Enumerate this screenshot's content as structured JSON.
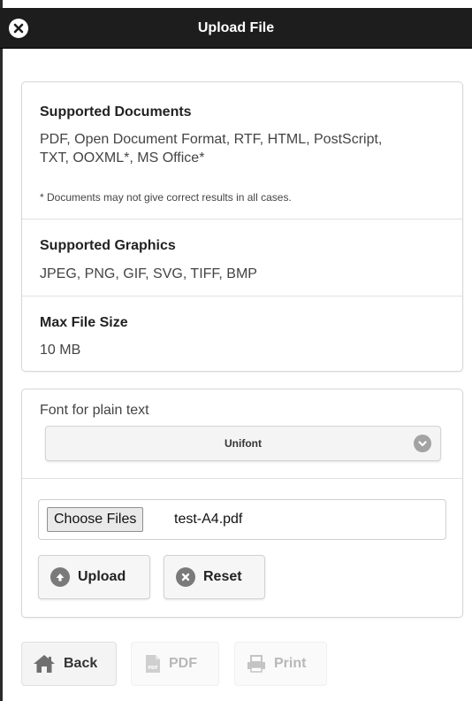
{
  "header": {
    "title": "Upload File"
  },
  "info": {
    "documents": {
      "heading": "Supported Documents",
      "line1": "PDF, Open Document Format, RTF, HTML, PostScript,",
      "line2": "TXT, OOXML*, MS Office*",
      "note": "* Documents may not give correct results in all cases."
    },
    "graphics": {
      "heading": "Supported Graphics",
      "text": "JPEG, PNG, GIF, SVG, TIFF, BMP"
    },
    "max_size": {
      "heading": "Max File Size",
      "text": "10 MB"
    }
  },
  "upload": {
    "font_label": "Font for plain text",
    "font_selected": "Unifont",
    "choose_label": "Choose Files",
    "file_name": "test-A4.pdf",
    "upload_label": "Upload",
    "reset_label": "Reset"
  },
  "nav": {
    "back_label": "Back",
    "pdf_label": "PDF",
    "print_label": "Print"
  },
  "colors": {
    "header_bg": "#1d1d1d",
    "icon_gray": "#7a7a7a",
    "disabled_text": "#b8b8b8"
  }
}
